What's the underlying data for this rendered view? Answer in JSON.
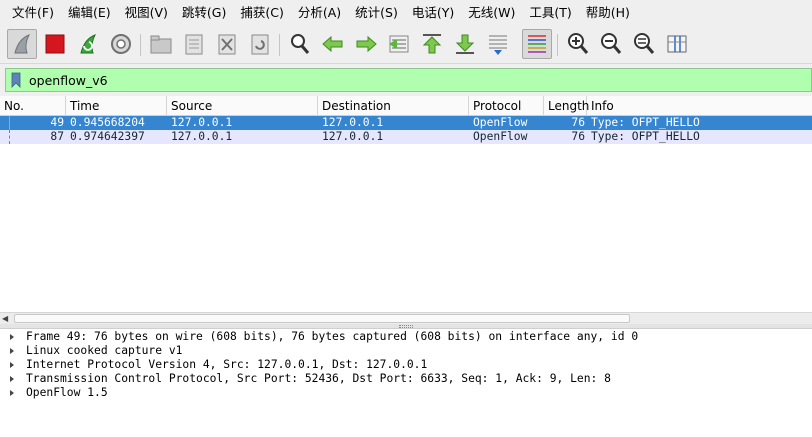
{
  "menu": [
    "文件(F)",
    "编辑(E)",
    "视图(V)",
    "跳转(G)",
    "捕获(C)",
    "分析(A)",
    "统计(S)",
    "电话(Y)",
    "无线(W)",
    "工具(T)",
    "帮助(H)"
  ],
  "toolbar": {
    "icons": [
      "shark-fin-start-icon",
      "stop-capture-icon",
      "restart-capture-icon",
      "capture-options-icon",
      "open-file-icon",
      "save-file-icon",
      "close-file-icon",
      "reload-file-icon",
      "find-packet-icon",
      "go-back-icon",
      "go-forward-icon",
      "go-to-packet-icon",
      "go-first-icon",
      "go-last-icon",
      "auto-scroll-icon",
      "colorize-icon",
      "zoom-in-icon",
      "zoom-out-icon",
      "zoom-normal-icon",
      "resize-columns-icon"
    ],
    "accent_red": "#d4171e",
    "accent_green": "#3aa83a"
  },
  "filter": {
    "value": "openflow_v6",
    "background": "#afffaf"
  },
  "packet_list": {
    "columns": [
      "No.",
      "Time",
      "Source",
      "Destination",
      "Protocol",
      "Length",
      "Info"
    ],
    "rows": [
      {
        "no": "49",
        "time": "0.945668204",
        "source": "127.0.0.1",
        "destination": "127.0.0.1",
        "protocol": "OpenFlow",
        "length": "76",
        "info": "Type: OFPT_HELLO"
      },
      {
        "no": "87",
        "time": "0.974642397",
        "source": "127.0.0.1",
        "destination": "127.0.0.1",
        "protocol": "OpenFlow",
        "length": "76",
        "info": "Type: OFPT_HELLO"
      }
    ],
    "selected_color": "#3585d0",
    "row_color": "#e7e6ff"
  },
  "details": [
    "Frame 49: 76 bytes on wire (608 bits), 76 bytes captured (608 bits) on interface any, id 0",
    "Linux cooked capture v1",
    "Internet Protocol Version 4, Src: 127.0.0.1, Dst: 127.0.0.1",
    "Transmission Control Protocol, Src Port: 52436, Dst Port: 6633, Seq: 1, Ack: 9, Len: 8",
    "OpenFlow 1.5"
  ]
}
